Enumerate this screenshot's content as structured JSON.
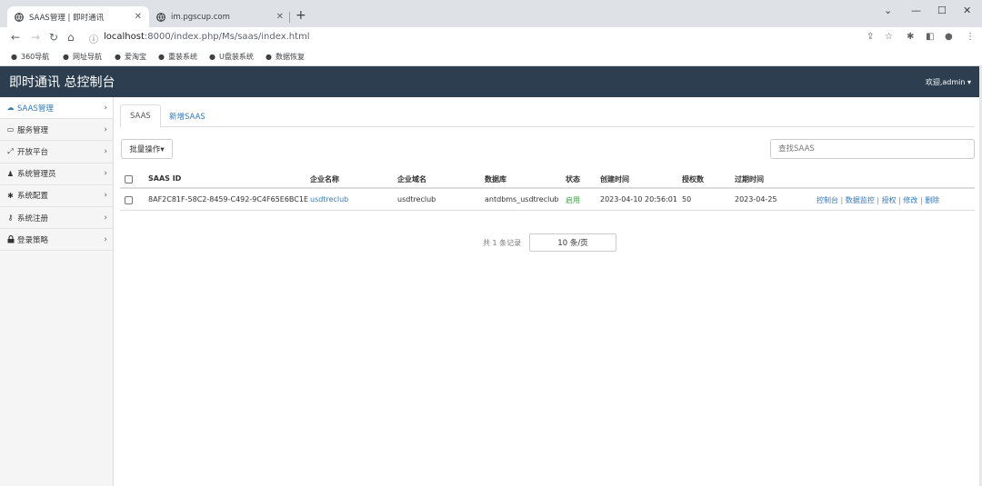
{
  "browser": {
    "tabs": [
      {
        "title": "SAAS管理 | 即时通讯",
        "active": true
      },
      {
        "title": "im.pgscup.com",
        "active": false
      }
    ],
    "new_tab": "+",
    "url_host": "localhost",
    "url_path": ":8000/index.php/Ms/saas/index.html",
    "bookmarks": [
      "360导航",
      "网址导航",
      "爱淘宝",
      "重装系统",
      "U盘装系统",
      "数据恢复"
    ]
  },
  "header": {
    "title": "即时通讯 总控制台",
    "welcome": "欢迎,admin ▾"
  },
  "sidebar": {
    "items": [
      {
        "label": "SAAS管理",
        "icon": "cloud-icon",
        "glyph": "☁",
        "active": true
      },
      {
        "label": "服务管理",
        "icon": "monitor-icon",
        "glyph": "▭",
        "active": false
      },
      {
        "label": "开放平台",
        "icon": "expand-icon",
        "glyph": "⤢",
        "active": false
      },
      {
        "label": "系统管理员",
        "icon": "user-icon",
        "glyph": "♟",
        "active": false
      },
      {
        "label": "系统配置",
        "icon": "gear-icon",
        "glyph": "✱",
        "active": false
      },
      {
        "label": "系统注册",
        "icon": "key-icon",
        "glyph": "⚷",
        "active": false
      },
      {
        "label": "登录策略",
        "icon": "lock-icon",
        "glyph": "🔒",
        "active": false
      }
    ]
  },
  "main": {
    "tabs": [
      {
        "label": "SAAS"
      },
      {
        "label": "新增SAAS"
      }
    ],
    "batch_label": "批量操作▾",
    "search_placeholder": "查找SAAS",
    "table": {
      "headers": [
        "SAAS ID",
        "企业名称",
        "企业域名",
        "数据库",
        "状态",
        "创建时间",
        "授权数",
        "过期时间"
      ],
      "rows": [
        {
          "saas_id": "8AF2C81F-58C2-8459-C492-9C4F65E6BC1E",
          "company": "usdtreclub",
          "domain": "usdtreclub",
          "database": "antdbms_usdtreclub",
          "status": "启用",
          "created": "2023-04-10 20:56:01",
          "licenses": "50",
          "expires": "2023-04-25",
          "actions": [
            "控制台",
            "数据监控",
            "授权",
            "修改",
            "删除"
          ]
        }
      ]
    },
    "pager_total": "共 1 条记录",
    "pager_size": "10 条/页"
  },
  "colors": {
    "header_bg": "#2d3e50",
    "link": "#337ab7",
    "status_ok": "#3c9d3c"
  }
}
